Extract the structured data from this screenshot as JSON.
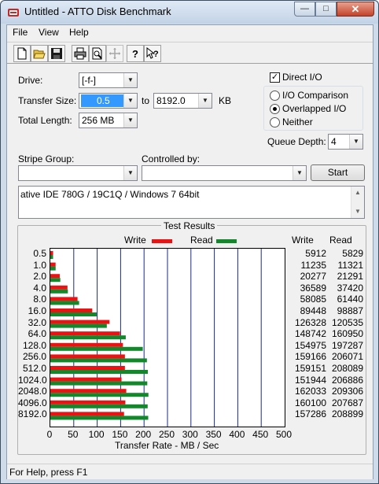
{
  "window": {
    "title": "Untitled - ATTO Disk Benchmark",
    "minimize": "—",
    "maximize": "□",
    "close": "✕"
  },
  "menu": [
    "File",
    "View",
    "Help"
  ],
  "toolbar_icons": [
    "new-document-icon",
    "open-folder-icon",
    "save-disk-icon",
    "print-icon",
    "print-preview-icon",
    "move-cross-icon",
    "help-question-icon",
    "context-help-icon"
  ],
  "form": {
    "drive_label": "Drive:",
    "drive_value": "[-f-]",
    "transfer_size_label": "Transfer Size:",
    "transfer_from": "0.5",
    "to_label": "to",
    "transfer_to": "8192.0",
    "kb_label": "KB",
    "total_length_label": "Total Length:",
    "total_length_value": "256 MB",
    "direct_io_label": "Direct I/O",
    "direct_io_checked": true,
    "io_comparison_label": "I/O Comparison",
    "overlapped_io_label": "Overlapped I/O",
    "neither_label": "Neither",
    "selected_mode": "Overlapped I/O",
    "queue_depth_label": "Queue Depth:",
    "queue_depth_value": "4",
    "stripe_group_label": "Stripe Group:",
    "stripe_group_value": "",
    "controlled_by_label": "Controlled by:",
    "controlled_by_value": "",
    "start_label": "Start",
    "description": "ative IDE 780G / 19C1Q / Windows 7 64bit"
  },
  "results": {
    "title": "Test Results",
    "write_legend": "Write",
    "read_legend": "Read",
    "write_header": "Write",
    "read_header": "Read",
    "write_color": "#ee1111",
    "read_color": "#11882a",
    "x_axis_label": "Transfer Rate - MB / Sec",
    "x_ticks": [
      "0",
      "50",
      "100",
      "150",
      "200",
      "250",
      "300",
      "350",
      "400",
      "450",
      "500"
    ]
  },
  "chart_data": {
    "type": "bar",
    "orientation": "horizontal",
    "categories": [
      "0.5",
      "1.0",
      "2.0",
      "4.0",
      "8.0",
      "16.0",
      "32.0",
      "64.0",
      "128.0",
      "256.0",
      "512.0",
      "1024.0",
      "2048.0",
      "4096.0",
      "8192.0"
    ],
    "series": [
      {
        "name": "Write",
        "values": [
          5912,
          11235,
          20277,
          36589,
          58085,
          89448,
          126328,
          148742,
          154975,
          159166,
          159151,
          151944,
          162033,
          160100,
          157286
        ]
      },
      {
        "name": "Read",
        "values": [
          5829,
          11321,
          21291,
          37420,
          61440,
          98887,
          120535,
          160950,
          197287,
          206071,
          208089,
          206886,
          209306,
          207687,
          208899
        ]
      }
    ],
    "xlabel": "Transfer Rate - MB / Sec",
    "xlim": [
      0,
      500
    ],
    "grid": true,
    "legend": "top"
  },
  "status": {
    "text": "For Help, press F1"
  }
}
